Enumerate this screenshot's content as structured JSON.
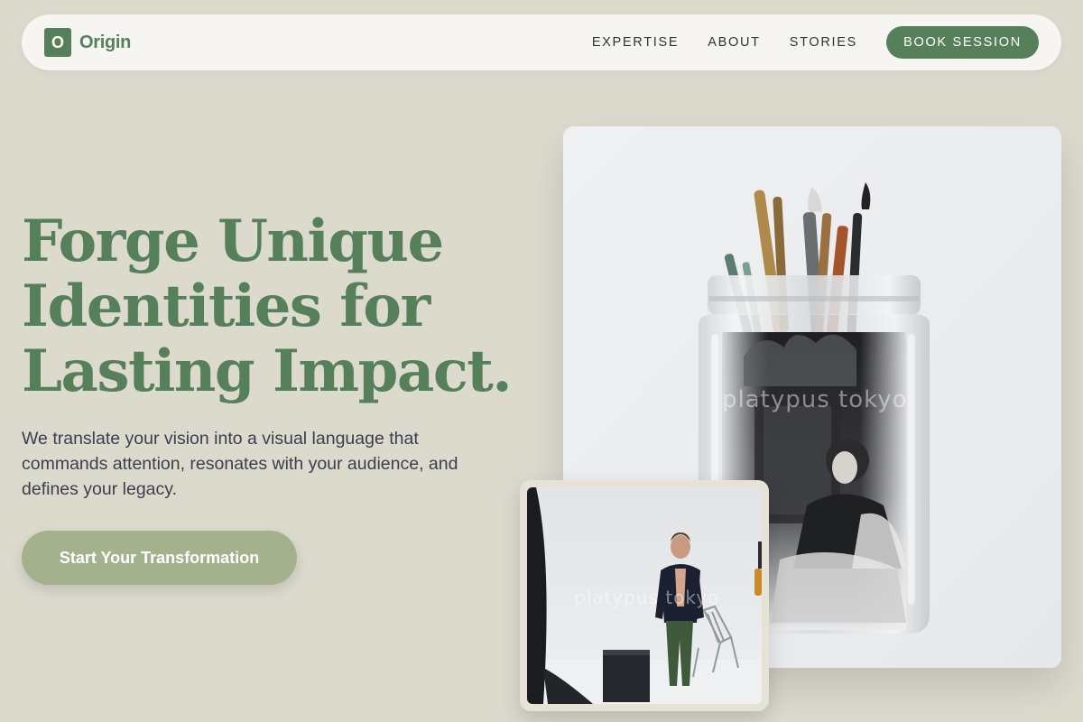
{
  "brand": {
    "mark": "O",
    "name": "Origin",
    "color": "#55805a"
  },
  "nav": {
    "links": [
      "EXPERTISE",
      "ABOUT",
      "STORIES"
    ],
    "cta": "BOOK SESSION"
  },
  "hero": {
    "title_lines": [
      "Forge Unique",
      "Identities for",
      "Lasting Impact."
    ],
    "subtitle": "We translate your vision into a visual language that commands attention, resonates with your audience, and defines your legacy.",
    "cta": "Start Your Transformation"
  },
  "images": {
    "main": {
      "watermark": "platypus tokyo"
    },
    "small": {
      "watermark": "platypus tokyo"
    }
  },
  "colors": {
    "background": "#dcd9cd",
    "accent": "#55805a",
    "cta_secondary": "#a3b18c",
    "nav_bg": "#f6f5f2"
  }
}
